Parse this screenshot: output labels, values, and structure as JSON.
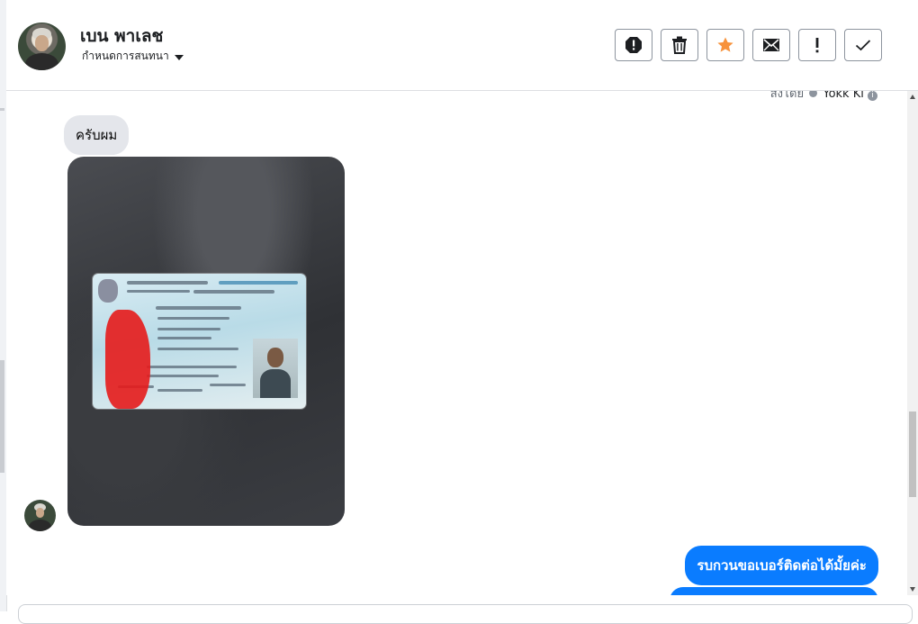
{
  "header": {
    "contact_name": "เบน พาเลช",
    "assign_label": "กำหนดการสนทนา",
    "actions": [
      {
        "name": "spam",
        "icon": "alert-circle-icon"
      },
      {
        "name": "delete",
        "icon": "trash-icon"
      },
      {
        "name": "star",
        "icon": "star-icon",
        "color": "#f7923b"
      },
      {
        "name": "mark-unread",
        "icon": "envelope-icon"
      },
      {
        "name": "follow-up",
        "icon": "exclamation-icon"
      },
      {
        "name": "mark-done",
        "icon": "check-icon"
      }
    ]
  },
  "conversation": {
    "sent_by_prefix": "ส่งโดย",
    "sent_by_name": "Yokk Ki",
    "messages": [
      {
        "direction": "incoming",
        "type": "text",
        "text": "ครับผม"
      },
      {
        "direction": "incoming",
        "type": "image",
        "image_description": "photo of Thai national ID card on dark background"
      },
      {
        "direction": "outgoing",
        "type": "text",
        "text": "รบกวนขอเบอร์ติดต่อได้มั้ยค่ะ"
      },
      {
        "direction": "outgoing",
        "type": "text",
        "text": ""
      }
    ]
  },
  "colors": {
    "outgoing_bubble": "#0a7cff",
    "incoming_bubble": "#e4e6eb",
    "star_accent": "#f7923b"
  }
}
